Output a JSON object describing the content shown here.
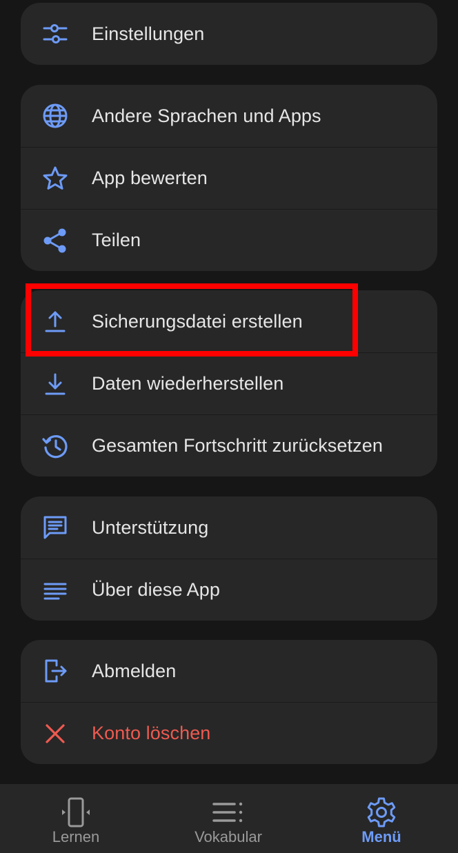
{
  "colors": {
    "background": "#161616",
    "card": "#272727",
    "accent": "#6d9bf7",
    "danger": "#ee5a50",
    "text": "#e6e6e6",
    "nav_inactive": "#9a9a9a",
    "highlight": "#ff0000"
  },
  "menu": {
    "groups": [
      {
        "items": [
          {
            "label": "Einstellungen",
            "icon": "sliders-icon"
          }
        ]
      },
      {
        "items": [
          {
            "label": "Andere Sprachen und Apps",
            "icon": "globe-icon"
          },
          {
            "label": "App bewerten",
            "icon": "star-icon"
          },
          {
            "label": "Teilen",
            "icon": "share-icon"
          }
        ]
      },
      {
        "items": [
          {
            "label": "Sicherungsdatei erstellen",
            "icon": "upload-icon"
          },
          {
            "label": "Daten wiederherstellen",
            "icon": "download-icon"
          },
          {
            "label": "Gesamten Fortschritt zurücksetzen",
            "icon": "history-icon"
          }
        ]
      },
      {
        "items": [
          {
            "label": "Unterstützung",
            "icon": "feedback-icon"
          },
          {
            "label": "Über diese App",
            "icon": "notes-icon"
          }
        ]
      },
      {
        "items": [
          {
            "label": "Abmelden",
            "icon": "logout-icon"
          },
          {
            "label": "Konto löschen",
            "icon": "close-icon"
          }
        ]
      }
    ]
  },
  "bottom_nav": {
    "items": [
      {
        "label": "Lernen",
        "icon": "phone-swipe-icon"
      },
      {
        "label": "Vokabular",
        "icon": "list-icon"
      },
      {
        "label": "Menü",
        "icon": "gear-icon",
        "active": true
      }
    ]
  }
}
